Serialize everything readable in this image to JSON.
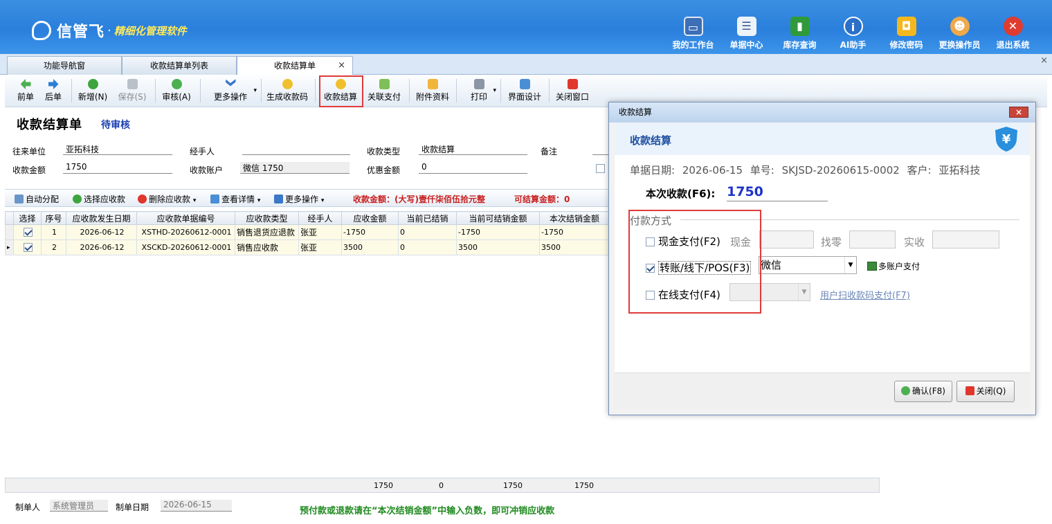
{
  "header": {
    "logo_name": "信管飞",
    "logo_dot": "·",
    "logo_slogan": "精细化管理软件",
    "nav": [
      {
        "label": "我的工作台",
        "icon": "monitor-icon"
      },
      {
        "label": "单据中心",
        "icon": "list-icon"
      },
      {
        "label": "库存查询",
        "icon": "book-icon"
      },
      {
        "label": "AI助手",
        "icon": "info-icon"
      },
      {
        "label": "修改密码",
        "icon": "lock-icon"
      },
      {
        "label": "更换操作员",
        "icon": "user-icon"
      },
      {
        "label": "退出系统",
        "icon": "exit-icon"
      }
    ]
  },
  "tabs": [
    {
      "label": "功能导航窗"
    },
    {
      "label": "收款结算单列表"
    },
    {
      "label": "收款结算单",
      "active": true,
      "close": "×"
    }
  ],
  "window_close": "×",
  "toolbar": {
    "prev": "前单",
    "next": "后单",
    "new": "新增(N)",
    "save": "保存(S)",
    "audit": "审核(A)",
    "more": "更多操作",
    "gen_code": "生成收款码",
    "settle": "收款结算",
    "link_pay": "关联支付",
    "attach": "附件资料",
    "print": "打印",
    "ui_design": "界面设计",
    "close_window": "关闭窗口",
    "dropdown_arrow": "▾"
  },
  "doc": {
    "title": "收款结算单",
    "status": "待审核",
    "fields": {
      "partner_label": "往来单位",
      "partner": "亚拓科技",
      "handler_label": "经手人",
      "handler": "",
      "type_label": "收款类型",
      "type": "收款结算",
      "remark_label": "备注",
      "amount_label": "收款金额",
      "amount": "1750",
      "account_label": "收款账户",
      "account": "微信 1750",
      "discount_label": "优惠金额",
      "discount": "0"
    }
  },
  "grid_toolbar": {
    "auto": "自动分配",
    "select": "选择应收款",
    "delete": "删除应收款",
    "detail": "查看详情",
    "more": "更多操作",
    "amount_text": "收款金额：(大写)壹仟柒佰伍拾元整",
    "available_text": "可结算金额：0"
  },
  "grid": {
    "columns": [
      "选择",
      "序号",
      "应收款发生日期",
      "应收款单据编号",
      "应收款类型",
      "经手人",
      "应收金额",
      "当前已结销",
      "当前可结销金额",
      "本次结销金额"
    ],
    "rows": [
      {
        "checked": true,
        "seq": "1",
        "date": "2026-06-12",
        "no": "XSTHD-20260612-0001",
        "type": "销售退货应退款",
        "handler": "张亚",
        "amount": "-1750",
        "settled": "0",
        "available": "-1750",
        "this": "-1750"
      },
      {
        "checked": true,
        "seq": "2",
        "date": "2026-06-12",
        "no": "XSCKD-20260612-0001",
        "type": "销售应收款",
        "handler": "张亚",
        "amount": "3500",
        "settled": "0",
        "available": "3500",
        "this": "3500",
        "current": "▸"
      }
    ],
    "totals": {
      "amount": "1750",
      "settled": "0",
      "available": "1750",
      "this": "1750"
    }
  },
  "footer": {
    "maker_label": "制单人",
    "maker": "系统管理员",
    "date_label": "制单日期",
    "date": "2026-06-15",
    "hint": "预付款或退款请在“本次结销金额”中输入负数，即可冲销应收款"
  },
  "dialog": {
    "window_title": "收款结算",
    "close_glyph": "×",
    "title": "收款结算",
    "shield_glyph": "¥",
    "info": "单据日期: 2026-06-15    单号: SKJSD-20260615-0002  客户: 亚拓科技",
    "amount_label": "本次收款(F6):",
    "amount": "1750",
    "group_label": "付款方式",
    "cash_label": "现金支付(F2)",
    "cash_checked": false,
    "cash_field": "现金",
    "change_field": "找零",
    "received_field": "实收",
    "transfer_label": "转账/线下/POS(F3)",
    "transfer_checked": true,
    "transfer_account": "微信",
    "multi_account": "多账户支付",
    "online_label": "在线支付(F4)",
    "online_checked": false,
    "online_account": "",
    "scan_link": "用户扫收款码支付(F7)",
    "confirm": "确认(F8)",
    "close": "关闭(Q)",
    "select_arrow": "▼"
  },
  "colors": {
    "header_blue": "#2a7fdc",
    "slogan_yellow": "#ffe95c",
    "status_blue": "#1a3fb0",
    "alert_red": "#c81e1e",
    "hint_green": "#1f8a1f",
    "highlight_box": "#e03a3a",
    "amount_blue": "#1c33c9"
  }
}
